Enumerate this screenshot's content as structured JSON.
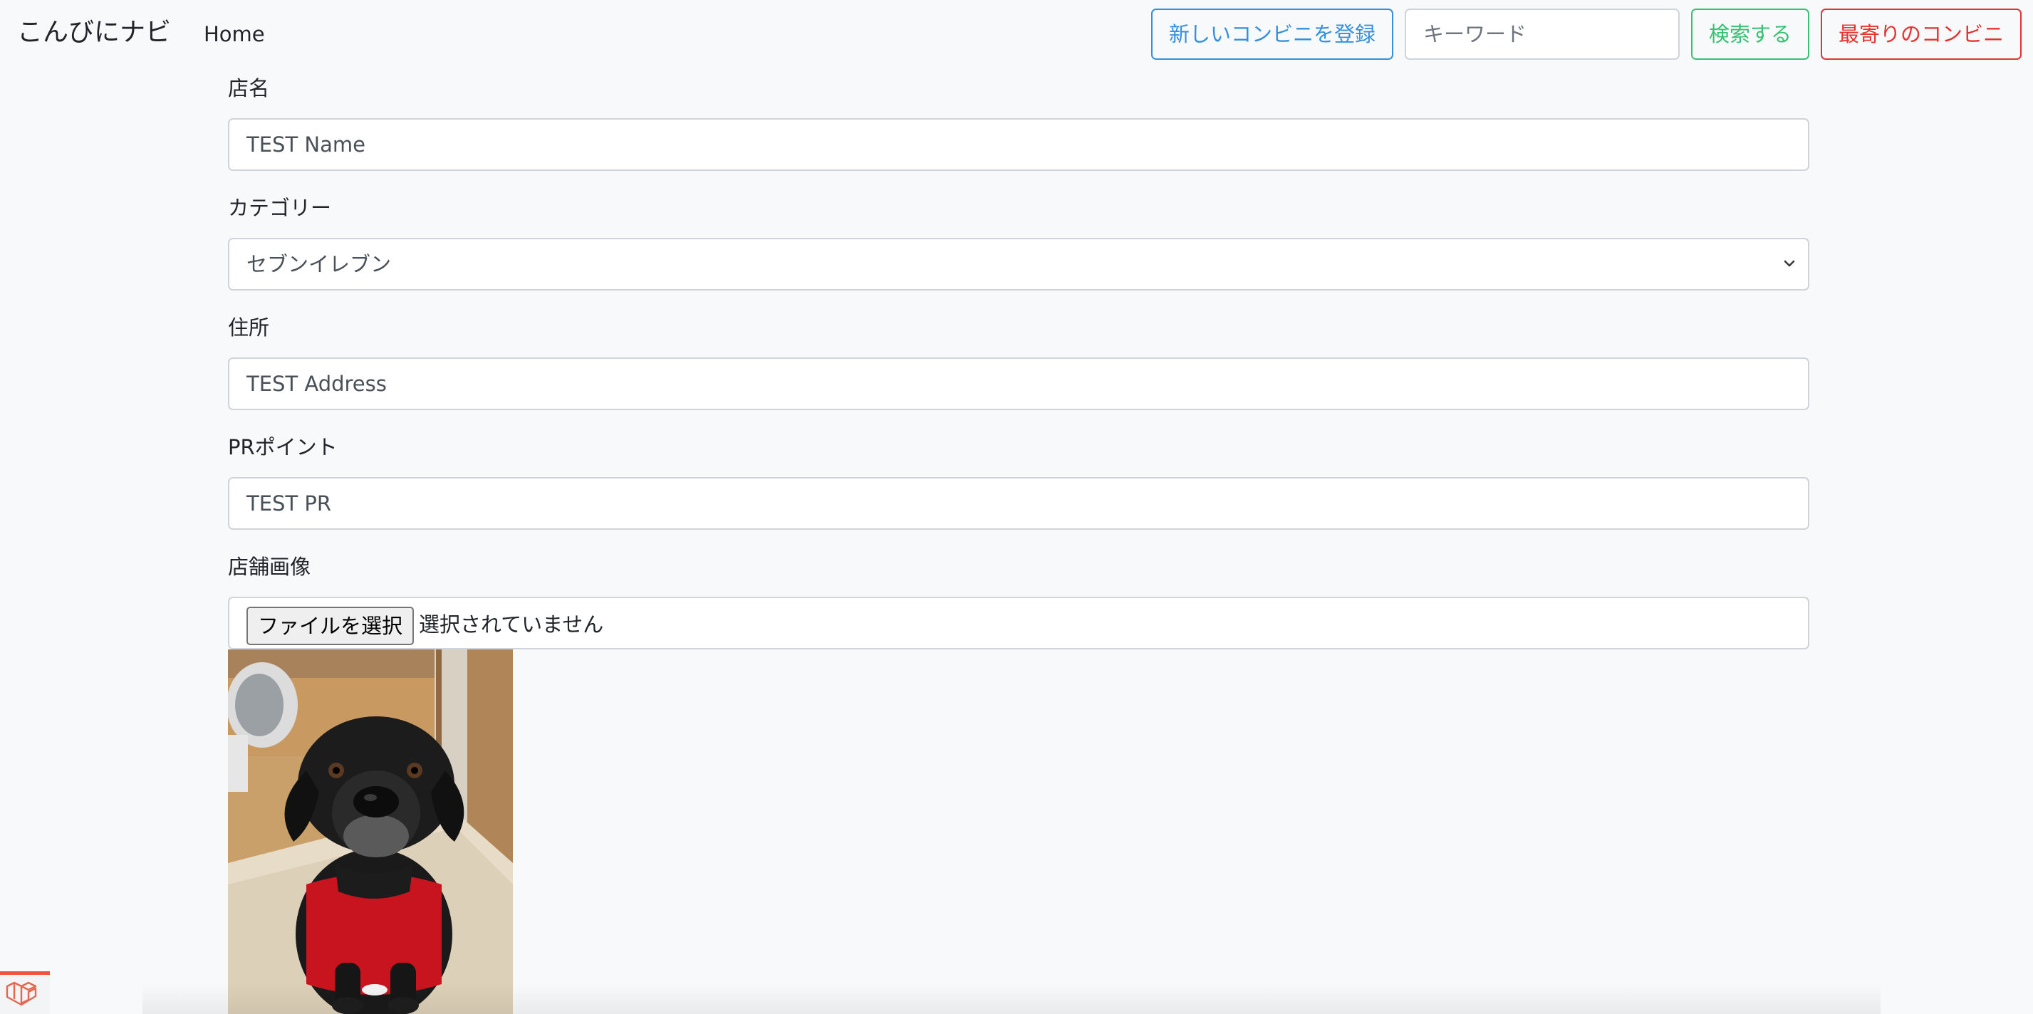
{
  "navbar": {
    "brand": "こんびにナビ",
    "home_link": "Home",
    "register_button": "新しいコンビニを登録",
    "search_placeholder": "キーワード",
    "search_button": "検索する",
    "nearest_button": "最寄りのコンビニ"
  },
  "form": {
    "name": {
      "label": "店名",
      "value": "TEST Name"
    },
    "category": {
      "label": "カテゴリー",
      "selected": "セブンイレブン"
    },
    "address": {
      "label": "住所",
      "value": "TEST Address"
    },
    "pr": {
      "label": "PRポイント",
      "value": "TEST PR"
    },
    "image": {
      "label": "店舗画像",
      "file_button": "ファイルを選択",
      "file_status": "選択されていません"
    }
  },
  "icons": {
    "select_arrow": "chevron-down-icon",
    "debug_badge": "laravel-logo-icon"
  },
  "colors": {
    "primary": "#3490dc",
    "success": "#38c172",
    "danger": "#e3342f",
    "background": "#f8f9fb"
  }
}
